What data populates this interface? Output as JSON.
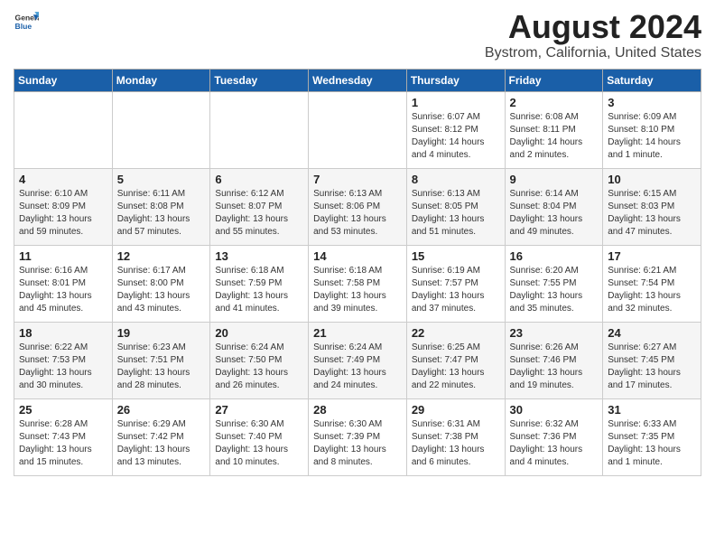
{
  "logo": {
    "general": "General",
    "blue": "Blue"
  },
  "title": {
    "month_year": "August 2024",
    "location": "Bystrom, California, United States"
  },
  "headers": [
    "Sunday",
    "Monday",
    "Tuesday",
    "Wednesday",
    "Thursday",
    "Friday",
    "Saturday"
  ],
  "weeks": [
    [
      {
        "num": "",
        "info": ""
      },
      {
        "num": "",
        "info": ""
      },
      {
        "num": "",
        "info": ""
      },
      {
        "num": "",
        "info": ""
      },
      {
        "num": "1",
        "info": "Sunrise: 6:07 AM\nSunset: 8:12 PM\nDaylight: 14 hours\nand 4 minutes."
      },
      {
        "num": "2",
        "info": "Sunrise: 6:08 AM\nSunset: 8:11 PM\nDaylight: 14 hours\nand 2 minutes."
      },
      {
        "num": "3",
        "info": "Sunrise: 6:09 AM\nSunset: 8:10 PM\nDaylight: 14 hours\nand 1 minute."
      }
    ],
    [
      {
        "num": "4",
        "info": "Sunrise: 6:10 AM\nSunset: 8:09 PM\nDaylight: 13 hours\nand 59 minutes."
      },
      {
        "num": "5",
        "info": "Sunrise: 6:11 AM\nSunset: 8:08 PM\nDaylight: 13 hours\nand 57 minutes."
      },
      {
        "num": "6",
        "info": "Sunrise: 6:12 AM\nSunset: 8:07 PM\nDaylight: 13 hours\nand 55 minutes."
      },
      {
        "num": "7",
        "info": "Sunrise: 6:13 AM\nSunset: 8:06 PM\nDaylight: 13 hours\nand 53 minutes."
      },
      {
        "num": "8",
        "info": "Sunrise: 6:13 AM\nSunset: 8:05 PM\nDaylight: 13 hours\nand 51 minutes."
      },
      {
        "num": "9",
        "info": "Sunrise: 6:14 AM\nSunset: 8:04 PM\nDaylight: 13 hours\nand 49 minutes."
      },
      {
        "num": "10",
        "info": "Sunrise: 6:15 AM\nSunset: 8:03 PM\nDaylight: 13 hours\nand 47 minutes."
      }
    ],
    [
      {
        "num": "11",
        "info": "Sunrise: 6:16 AM\nSunset: 8:01 PM\nDaylight: 13 hours\nand 45 minutes."
      },
      {
        "num": "12",
        "info": "Sunrise: 6:17 AM\nSunset: 8:00 PM\nDaylight: 13 hours\nand 43 minutes."
      },
      {
        "num": "13",
        "info": "Sunrise: 6:18 AM\nSunset: 7:59 PM\nDaylight: 13 hours\nand 41 minutes."
      },
      {
        "num": "14",
        "info": "Sunrise: 6:18 AM\nSunset: 7:58 PM\nDaylight: 13 hours\nand 39 minutes."
      },
      {
        "num": "15",
        "info": "Sunrise: 6:19 AM\nSunset: 7:57 PM\nDaylight: 13 hours\nand 37 minutes."
      },
      {
        "num": "16",
        "info": "Sunrise: 6:20 AM\nSunset: 7:55 PM\nDaylight: 13 hours\nand 35 minutes."
      },
      {
        "num": "17",
        "info": "Sunrise: 6:21 AM\nSunset: 7:54 PM\nDaylight: 13 hours\nand 32 minutes."
      }
    ],
    [
      {
        "num": "18",
        "info": "Sunrise: 6:22 AM\nSunset: 7:53 PM\nDaylight: 13 hours\nand 30 minutes."
      },
      {
        "num": "19",
        "info": "Sunrise: 6:23 AM\nSunset: 7:51 PM\nDaylight: 13 hours\nand 28 minutes."
      },
      {
        "num": "20",
        "info": "Sunrise: 6:24 AM\nSunset: 7:50 PM\nDaylight: 13 hours\nand 26 minutes."
      },
      {
        "num": "21",
        "info": "Sunrise: 6:24 AM\nSunset: 7:49 PM\nDaylight: 13 hours\nand 24 minutes."
      },
      {
        "num": "22",
        "info": "Sunrise: 6:25 AM\nSunset: 7:47 PM\nDaylight: 13 hours\nand 22 minutes."
      },
      {
        "num": "23",
        "info": "Sunrise: 6:26 AM\nSunset: 7:46 PM\nDaylight: 13 hours\nand 19 minutes."
      },
      {
        "num": "24",
        "info": "Sunrise: 6:27 AM\nSunset: 7:45 PM\nDaylight: 13 hours\nand 17 minutes."
      }
    ],
    [
      {
        "num": "25",
        "info": "Sunrise: 6:28 AM\nSunset: 7:43 PM\nDaylight: 13 hours\nand 15 minutes."
      },
      {
        "num": "26",
        "info": "Sunrise: 6:29 AM\nSunset: 7:42 PM\nDaylight: 13 hours\nand 13 minutes."
      },
      {
        "num": "27",
        "info": "Sunrise: 6:30 AM\nSunset: 7:40 PM\nDaylight: 13 hours\nand 10 minutes."
      },
      {
        "num": "28",
        "info": "Sunrise: 6:30 AM\nSunset: 7:39 PM\nDaylight: 13 hours\nand 8 minutes."
      },
      {
        "num": "29",
        "info": "Sunrise: 6:31 AM\nSunset: 7:38 PM\nDaylight: 13 hours\nand 6 minutes."
      },
      {
        "num": "30",
        "info": "Sunrise: 6:32 AM\nSunset: 7:36 PM\nDaylight: 13 hours\nand 4 minutes."
      },
      {
        "num": "31",
        "info": "Sunrise: 6:33 AM\nSunset: 7:35 PM\nDaylight: 13 hours\nand 1 minute."
      }
    ]
  ]
}
